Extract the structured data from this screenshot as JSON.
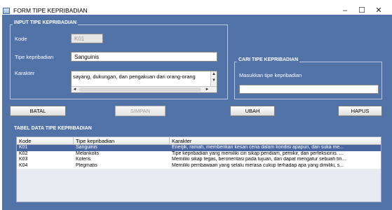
{
  "window": {
    "title": "FORM TIPE KEPRIBADIAN",
    "minimize": "–",
    "maximize": "☐",
    "close": "✕"
  },
  "input_panel": {
    "title": "INPUT TIPE KEPRIBADIAN",
    "kode_label": "Kode",
    "kode_value": "K01",
    "tipe_label": "Tipe kepribadian",
    "tipe_value": "Sanguinis",
    "karakter_label": "Karakter",
    "karakter_value": "sayang, dukungan, dan pengakuan dari orang-orang"
  },
  "search_panel": {
    "title": "CARI TIPE KEPRIBADIAN",
    "prompt": "Masukkan tipe kepribadian",
    "value": ""
  },
  "buttons": {
    "batal": "BATAL",
    "simpan": "SIMPAN",
    "ubah": "UBAH",
    "hapus": "HAPUS"
  },
  "table": {
    "title": "TABEL DATA TIPE KEPRIBADIAN",
    "columns": [
      "Kode",
      "Tipe kepribadian",
      "Karakter"
    ],
    "rows": [
      {
        "kode": "K01",
        "tipe": "Sanguinis",
        "karakter": "Enerjik, ramah, memberikan kesan ceria dalam kondisi apapun, dan suka me..."
      },
      {
        "kode": "K02",
        "tipe": "Melankolis",
        "karakter": "Tipe kepribadian yang memiliki ciri sikap pendiam, pemikir, dan perfeksionis. ..."
      },
      {
        "kode": "K03",
        "tipe": "Koleris",
        "karakter": "Memiliki sikap tegas, berorientasi pada tujuan, dan dapat mengatur sebuah tin..."
      },
      {
        "kode": "K04",
        "tipe": "Plegmatis",
        "karakter": "Memiliki pembawaan yang selalu merasa cukup terhadap apa yang dimiliki, s..."
      }
    ],
    "selected_index": 0
  },
  "colors": {
    "background": "#5273a8",
    "selection": "#4a66a0"
  }
}
